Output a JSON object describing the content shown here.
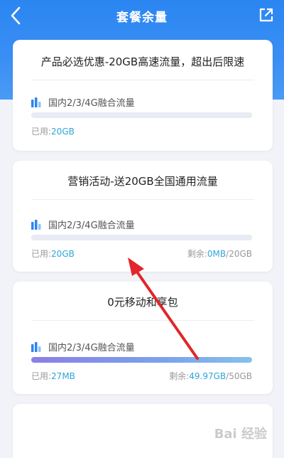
{
  "header": {
    "title": "套餐余量"
  },
  "cards": [
    {
      "title": "产品必选优惠-20GB高速流量，超出后限速",
      "item_label": "国内2/3/4G融合流量",
      "used_label": "已用:",
      "used_value": "20GB",
      "remain_label": "",
      "remain_value": "",
      "remain_total": "",
      "progress": 0
    },
    {
      "title": "营销活动-送20GB全国通用流量",
      "item_label": "国内2/3/4G融合流量",
      "used_label": "已用:",
      "used_value": "20GB",
      "remain_label": "剩余:",
      "remain_value": "0MB",
      "remain_total": "/20GB",
      "progress": 0
    },
    {
      "title": "0元移动和享包",
      "item_label": "国内2/3/4G融合流量",
      "used_label": "已用:",
      "used_value": "27MB",
      "remain_label": "剩余:",
      "remain_value": "49.97GB",
      "remain_total": "/50GB",
      "progress": 0.9995
    }
  ],
  "colors": {
    "header_blue": "#2b86f2",
    "value_blue": "#2ea5d8",
    "arrow_red": "#e0262b"
  },
  "icons": {
    "back": "chevron-left-icon",
    "share": "share-external-icon",
    "traffic": "bar-chart-icon"
  },
  "watermark": "Bai 经验"
}
